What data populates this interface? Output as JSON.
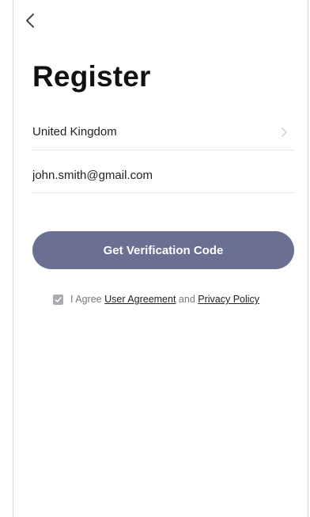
{
  "page": {
    "title": "Register"
  },
  "form": {
    "country": "United Kingdom",
    "email": "john.smith@gmail.com"
  },
  "actions": {
    "verify_label": "Get Verification Code"
  },
  "agreement": {
    "prefix": "I Agree",
    "user_agreement": "User Agreement",
    "conjunction": "and",
    "privacy_policy": "Privacy Policy",
    "checked": true
  },
  "icons": {
    "back": "chevron-left-icon",
    "country_arrow": "chevron-right-icon",
    "check": "check-icon"
  },
  "colors": {
    "primary_button": "#6a7092",
    "checkbox": "#a9abb1"
  }
}
